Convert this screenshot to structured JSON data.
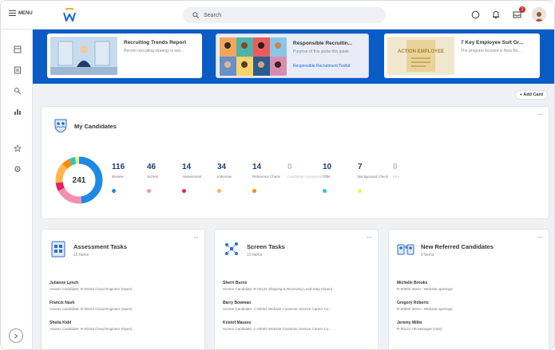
{
  "topbar": {
    "menu_label": "MENU",
    "search_placeholder": "Search",
    "notification_count": "1"
  },
  "banner": {
    "cards": [
      {
        "title": "Recruiting Trends Report",
        "subtitle": "Recent recruiting strategy is see...",
        "link": ""
      },
      {
        "title": "Responsible Recruitin...",
        "subtitle": "Purpose of this guide this guide",
        "link": "Responsible Recruitment Toolkit"
      },
      {
        "title": "7 Key Employee Suit Gr...",
        "subtitle": "The program focused is New Re...",
        "link": ""
      }
    ],
    "card3_image_text": "ACTION EMPLOYEE"
  },
  "add_card_label": "+ Add Card",
  "candidates": {
    "title": "My Candidates",
    "total": "241",
    "stages": [
      {
        "num": "116",
        "label": "Review",
        "color": "#1e88e5",
        "dim": false
      },
      {
        "num": "46",
        "label": "Screen",
        "color": "#f48fb1",
        "dim": false
      },
      {
        "num": "14",
        "label": "Assessment",
        "color": "#e91e63",
        "dim": false
      },
      {
        "num": "34",
        "label": "Interview",
        "color": "#ffb74d",
        "dim": false
      },
      {
        "num": "14",
        "label": "Reference Check",
        "color": "#fb8c00",
        "dim": false
      },
      {
        "num": "0",
        "label": "Candidate Agreement",
        "color": "",
        "dim": true
      },
      {
        "num": "10",
        "label": "Offer",
        "color": "#26c6da",
        "dim": false
      },
      {
        "num": "7",
        "label": "Background Check",
        "color": "#ffee58",
        "dim": false
      },
      {
        "num": "0",
        "label": "Hire",
        "color": "",
        "dim": true
      }
    ]
  },
  "assessment": {
    "title": "Assessment Tasks",
    "subtitle": "10 Items",
    "items": [
      {
        "name": "Julianne Lynch",
        "desc": "Assess Candidate: R-00164 Cloud Engineer (Open)"
      },
      {
        "name": "Francis Nash",
        "desc": "Assess Candidate: R-00164 Cloud Engineer (Open)"
      },
      {
        "name": "Sheila Kidd",
        "desc": "Assess Candidate: R-00164 Cloud Engineer (Open)"
      }
    ]
  },
  "screen": {
    "title": "Screen Tasks",
    "subtitle": "10 Items",
    "items": [
      {
        "name": "Sherri Burns",
        "desc": "Screen Candidate: R-00121 Shipping & Receiving Lead-m&p (Open)"
      },
      {
        "name": "Barry Bowman",
        "desc": "Screen Candidate: C-00001 Website Customer Service Career Co..."
      },
      {
        "name": "Kristof Mauzes",
        "desc": "Screen Candidate: C-00003 Website Customer Service Career Co..."
      }
    ]
  },
  "referred": {
    "title": "New Referred Candidates",
    "subtitle": "9 Items",
    "items": [
      {
        "name": "Michelle Brooks",
        "desc": "R-00002 Intern - Website openings"
      },
      {
        "name": "Gregory Roberts",
        "desc": "R-00002 Intern - Website openings"
      },
      {
        "name": "Jeremy Miller",
        "desc": "R-00121 HR Manager (Hire)"
      }
    ]
  }
}
